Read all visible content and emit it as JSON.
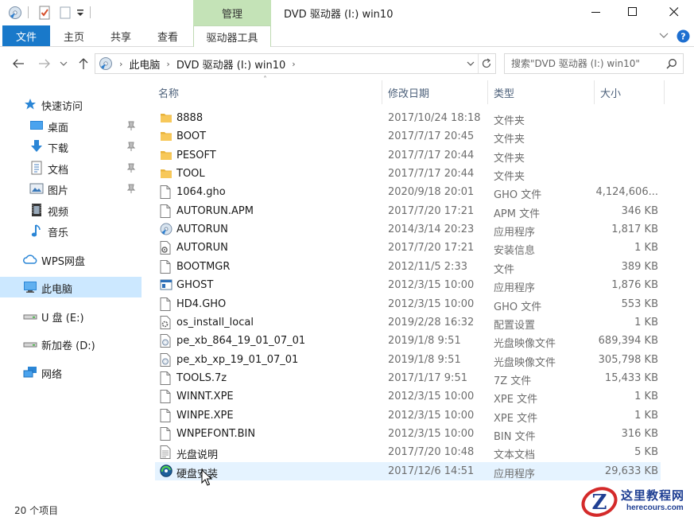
{
  "titlebar": {
    "context_tab_label": "管理",
    "window_title": "DVD 驱动器 (I:) win10"
  },
  "ribbon": {
    "tabs": [
      "文件",
      "主页",
      "共享",
      "查看",
      "驱动器工具"
    ]
  },
  "address": {
    "crumbs": [
      "此电脑",
      "DVD 驱动器 (I:) win10"
    ],
    "search_placeholder": "搜索\"DVD 驱动器 (I:) win10\""
  },
  "nav": {
    "items": [
      {
        "label": "快速访问",
        "icon": "star-icon",
        "pinned": false
      },
      {
        "label": "桌面",
        "icon": "desktop-icon",
        "pinned": true
      },
      {
        "label": "下载",
        "icon": "download-icon",
        "pinned": true
      },
      {
        "label": "文档",
        "icon": "document-icon",
        "pinned": true
      },
      {
        "label": "图片",
        "icon": "pictures-icon",
        "pinned": true
      },
      {
        "label": "视频",
        "icon": "video-icon",
        "pinned": false
      },
      {
        "label": "音乐",
        "icon": "music-icon",
        "pinned": false
      },
      {
        "label": "WPS网盘",
        "icon": "cloud-icon",
        "pinned": false
      },
      {
        "label": "此电脑",
        "icon": "computer-icon",
        "pinned": false,
        "selected": true
      },
      {
        "label": "U 盘 (E:)",
        "icon": "usb-drive-icon",
        "pinned": false
      },
      {
        "label": "新加卷 (D:)",
        "icon": "drive-icon",
        "pinned": false
      },
      {
        "label": "网络",
        "icon": "network-icon",
        "pinned": false
      }
    ]
  },
  "columns": {
    "name": "名称",
    "date": "修改日期",
    "type": "类型",
    "size": "大小"
  },
  "files": [
    {
      "name": "8888",
      "date": "2017/10/24 18:18",
      "type": "文件夹",
      "size": "",
      "icon": "folder"
    },
    {
      "name": "BOOT",
      "date": "2017/7/17 20:45",
      "type": "文件夹",
      "size": "",
      "icon": "folder"
    },
    {
      "name": "PESOFT",
      "date": "2017/7/17 20:44",
      "type": "文件夹",
      "size": "",
      "icon": "folder"
    },
    {
      "name": "TOOL",
      "date": "2017/7/17 20:44",
      "type": "文件夹",
      "size": "",
      "icon": "folder"
    },
    {
      "name": "1064.gho",
      "date": "2020/9/18 20:01",
      "type": "GHO 文件",
      "size": "4,124,606...",
      "icon": "file"
    },
    {
      "name": "AUTORUN.APM",
      "date": "2017/7/20 17:21",
      "type": "APM 文件",
      "size": "346 KB",
      "icon": "file"
    },
    {
      "name": "AUTORUN",
      "date": "2014/3/14 20:23",
      "type": "应用程序",
      "size": "1,817 KB",
      "icon": "cd-app"
    },
    {
      "name": "AUTORUN",
      "date": "2017/7/20 17:21",
      "type": "安装信息",
      "size": "1 KB",
      "icon": "setup"
    },
    {
      "name": "BOOTMGR",
      "date": "2012/11/5 2:33",
      "type": "文件",
      "size": "389 KB",
      "icon": "file"
    },
    {
      "name": "GHOST",
      "date": "2012/3/15 10:00",
      "type": "应用程序",
      "size": "1,876 KB",
      "icon": "exe"
    },
    {
      "name": "HD4.GHO",
      "date": "2012/3/15 10:00",
      "type": "GHO 文件",
      "size": "553 KB",
      "icon": "file"
    },
    {
      "name": "os_install_local",
      "date": "2019/2/28 16:32",
      "type": "配置设置",
      "size": "1 KB",
      "icon": "config"
    },
    {
      "name": "pe_xb_864_19_01_07_01",
      "date": "2019/1/8 9:51",
      "type": "光盘映像文件",
      "size": "689,394 KB",
      "icon": "disc"
    },
    {
      "name": "pe_xb_xp_19_01_07_01",
      "date": "2019/1/8 9:51",
      "type": "光盘映像文件",
      "size": "305,798 KB",
      "icon": "disc"
    },
    {
      "name": "TOOLS.7z",
      "date": "2017/1/17 9:51",
      "type": "7Z 文件",
      "size": "15,433 KB",
      "icon": "file"
    },
    {
      "name": "WINNT.XPE",
      "date": "2012/3/15 10:00",
      "type": "XPE 文件",
      "size": "1 KB",
      "icon": "file"
    },
    {
      "name": "WINPE.XPE",
      "date": "2012/3/15 10:00",
      "type": "XPE 文件",
      "size": "1 KB",
      "icon": "file"
    },
    {
      "name": "WNPEFONT.BIN",
      "date": "2012/3/15 10:00",
      "type": "BIN 文件",
      "size": "316 KB",
      "icon": "file"
    },
    {
      "name": "光盘说明",
      "date": "2017/7/20 10:48",
      "type": "文本文档",
      "size": "5 KB",
      "icon": "text"
    },
    {
      "name": "硬盘安装",
      "date": "2017/12/6 14:51",
      "type": "应用程序",
      "size": "29,633 KB",
      "icon": "installer",
      "selected": true
    }
  ],
  "status": {
    "item_count": "20 个项目"
  },
  "watermark": {
    "title": "这里教程网",
    "url": "herecours.com"
  },
  "colors": {
    "accent": "#1979ca",
    "context_tab": "#c4e3b7",
    "selection": "#cce8ff",
    "folder": "#f7c85a"
  }
}
